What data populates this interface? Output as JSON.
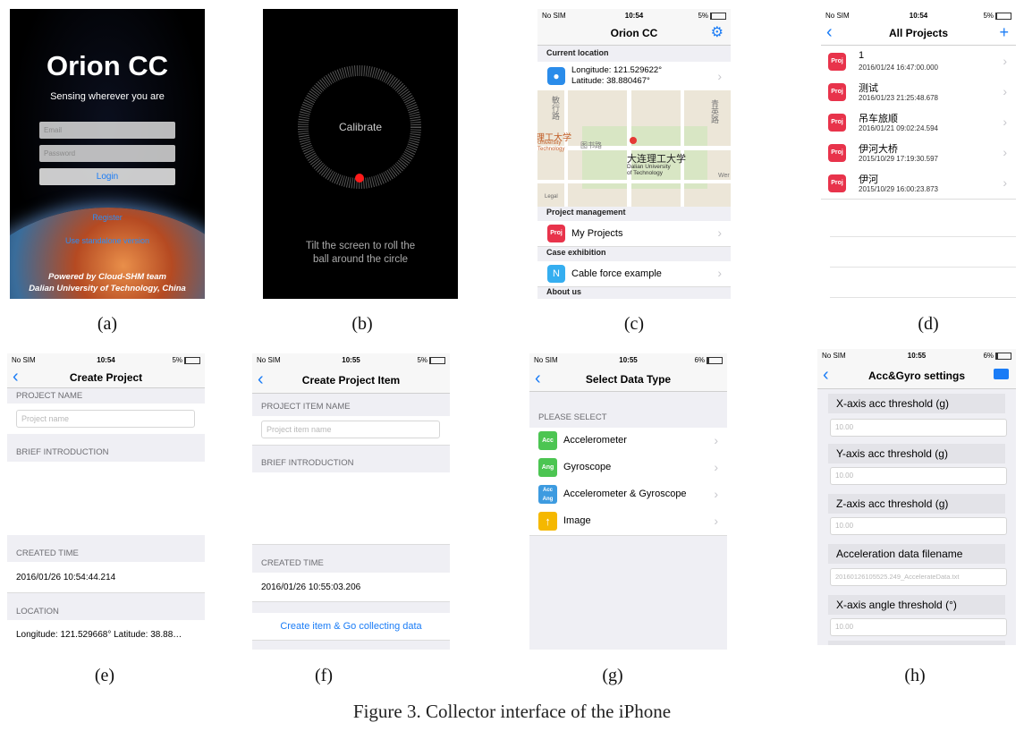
{
  "screen_a": {
    "app_title": "Orion CC",
    "tagline": "Sensing wherever you are",
    "email_placeholder": "Email",
    "password_placeholder": "Password",
    "login_label": "Login",
    "register_label": "Register",
    "standalone_label": "Use standalone version",
    "powered_line1": "Powered by Cloud-SHM team",
    "powered_line2": "Dalian University of Technology, China",
    "caption": "(a)"
  },
  "screen_b": {
    "calibrate_label": "Calibrate",
    "instruction": "Tilt the screen to roll the ball around the circle",
    "caption": "(b)"
  },
  "screen_c": {
    "status": {
      "carrier": "No SIM",
      "time": "10:54",
      "battery": "5%"
    },
    "nav_title": "Orion CC",
    "current_location_header": "Current location",
    "longitude": "Longitude: 121.529622°",
    "latitude": "Latitude: 38.880467°",
    "map_labels": {
      "campus_cn": "大连理工大学",
      "campus_en1": "Dalian University",
      "campus_en2": "of Technology",
      "left_cn": "理工大学",
      "left_en1": "University",
      "left_en2": "Technology",
      "west": "Wer",
      "legal": "Legal",
      "road_cn1": "敏行路",
      "road_cn2": "图书路",
      "road_cn3": "青英路"
    },
    "project_mgmt_header": "Project management",
    "my_projects": "My Projects",
    "case_header": "Case exhibition",
    "cable_example": "Cable force example",
    "about_header": "About us",
    "proj_badge": "Proj",
    "n_badge": "N",
    "caption": "(c)"
  },
  "screen_d": {
    "status": {
      "carrier": "No SIM",
      "time": "10:54",
      "battery": "5%"
    },
    "nav_title": "All Projects",
    "projects": [
      {
        "name": "1",
        "time": "2016/01/24 16:47:00.000"
      },
      {
        "name": "测试",
        "time": "2016/01/23 21:25:48.678"
      },
      {
        "name": "吊车旅顺",
        "time": "2016/01/21 09:02:24.594"
      },
      {
        "name": "伊河大桥",
        "time": "2015/10/29 17:19:30.597"
      },
      {
        "name": "伊河",
        "time": "2015/10/29 16:00:23.873"
      }
    ],
    "proj_badge": "Proj",
    "caption": "(d)"
  },
  "screen_e": {
    "status": {
      "carrier": "No SIM",
      "time": "10:54",
      "battery": "5%"
    },
    "nav_title": "Create Project",
    "project_name_header": "PROJECT NAME",
    "project_name_placeholder": "Project name",
    "brief_header": "BRIEF INTRODUCTION",
    "created_header": "CREATED TIME",
    "created_value": "2016/01/26 10:54:44.214",
    "location_header": "LOCATION",
    "location_value": "Longitude: 121.529668° Latitude: 38.88…",
    "caption": "(e)"
  },
  "screen_f": {
    "status": {
      "carrier": "No SIM",
      "time": "10:55",
      "battery": "5%"
    },
    "nav_title": "Create Project Item",
    "item_name_header": "PROJECT ITEM NAME",
    "item_name_placeholder": "Project item name",
    "brief_header": "BRIEF INTRODUCTION",
    "created_header": "CREATED TIME",
    "created_value": "2016/01/26 10:55:03.206",
    "create_button": "Create item & Go collecting data",
    "caption": "(f)"
  },
  "screen_g": {
    "status": {
      "carrier": "No SIM",
      "time": "10:55",
      "battery": "6%"
    },
    "nav_title": "Select Data Type",
    "please_select": "PLEASE SELECT",
    "items": [
      {
        "label": "Accelerometer",
        "icon_text": "Acc",
        "color": "#4cc552"
      },
      {
        "label": "Gyroscope",
        "icon_text": "Ang",
        "color": "#4cc552"
      },
      {
        "label": "Accelerometer & Gyroscope",
        "icon_text": "Acc Ang",
        "color": "#3d9be0"
      },
      {
        "label": "Image",
        "icon_text": "↑",
        "color": "#f5b800"
      }
    ],
    "caption": "(g)"
  },
  "screen_h": {
    "status": {
      "carrier": "No SIM",
      "time": "10:55",
      "battery": "6%"
    },
    "nav_title": "Acc&Gyro settings",
    "fields": [
      {
        "label": "X-axis acc threshold (g)",
        "placeholder": "10.00"
      },
      {
        "label": "Y-axis acc threshold (g)",
        "placeholder": "10.00"
      },
      {
        "label": "Z-axis acc threshold (g)",
        "placeholder": "10.00"
      },
      {
        "label": "Acceleration data filename",
        "placeholder": "20160126105525.249_AccelerateData.txt"
      },
      {
        "label": "X-axis angle threshold (°)",
        "placeholder": "10.00"
      }
    ],
    "caption": "(h)"
  },
  "figure_caption": "Figure 3. Collector interface of the iPhone",
  "colors": {
    "ios_blue": "#1a7cf6",
    "proj_red": "#e8334b",
    "group_bg": "#efeff4"
  }
}
